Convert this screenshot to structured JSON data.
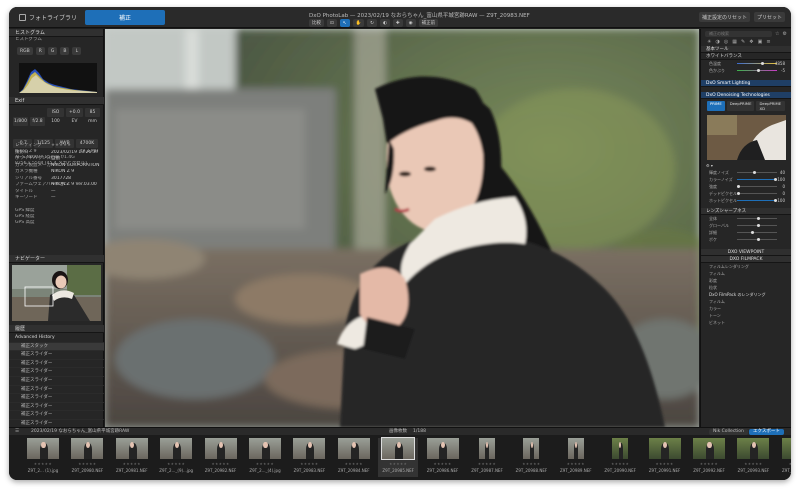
{
  "app": {
    "tab_library": "フォトライブラリ",
    "tab_edit": "補正",
    "window_title": "DxO PhotoLab — 2023/02/19 なおらちゃん_富山県平城宮跡RAW — Z9T_20983.NEF",
    "btn_compare": "比較",
    "btn_reset": "補正設定のリセット",
    "btn_preset": "プリセット",
    "btn_before": "補正前"
  },
  "left": {
    "histogram_header": "ヒストグラム",
    "histogram_label": "ヒストグラム",
    "exif_header": "Exif",
    "exif_row1": [
      "1/800",
      "f/2.8",
      "ISO 100",
      "+0.0 EV",
      "85 mm"
    ],
    "exif_row2": [
      "-0.7",
      "1/125",
      "AWB",
      "4700K"
    ],
    "camera": "Nikon Z 9",
    "camera_size": "49.1 MB",
    "lens": "AF-S NIKKOR 85mm f/1.4G",
    "dims": "8256 x 5504 (45.4 メガピクセル)",
    "meta_rows": [
      {
        "k": "レーティング",
        "v": "★★★★★"
      },
      {
        "k": "撮影日",
        "v": "2023/02/19 13:26:37"
      },
      {
        "k": "ホワイトバランス",
        "v": "自動"
      },
      {
        "k": "カメラ製造メーカー",
        "v": "NIKON CORPORATION"
      },
      {
        "k": "カメラ機種",
        "v": "NIKON Z 9"
      },
      {
        "k": "シリアル番号",
        "v": "3017728"
      },
      {
        "k": "ファームウェアバージョン",
        "v": "NIKON Z 9 Ver.03.00"
      },
      {
        "k": "タイトル",
        "v": "—"
      },
      {
        "k": "キーワード",
        "v": "—"
      }
    ],
    "gps_rows": [
      "GPS 緯度",
      "GPS 経度",
      "GPS 高度"
    ],
    "nav_header": "ナビゲーター",
    "history_header": "履歴",
    "history_group": "Advanced History",
    "history_items": [
      "補正スタック",
      "補正スライダー",
      "補正スライダー",
      "補正スライダー",
      "補正スライダー",
      "補正スライダー",
      "補正スライダー",
      "補正スライダー",
      "補正スライダー",
      "補正スライダー"
    ]
  },
  "right": {
    "search_placeholder": "補正の検索",
    "essential": "基本ツール",
    "wb": "ホワイトバランス",
    "wb_rows": [
      {
        "k": "色温度",
        "v": "4858"
      },
      {
        "k": "色かぶり",
        "v": "-5"
      }
    ],
    "smart": "DxO Smart Lighting",
    "deep": "DxO Denoising Technologies",
    "deep_mode1": "PRIME",
    "deep_mode2": "DeepPRIME",
    "deep_mode3": "DeepPRIME XD",
    "sliders": [
      {
        "k": "輝度ノイズ",
        "v": "40"
      },
      {
        "k": "カラーノイズ",
        "v": "100"
      },
      {
        "k": "強度",
        "v": "0"
      },
      {
        "k": "デッドピクセル",
        "v": "0"
      },
      {
        "k": "ホットピクセル",
        "v": "100"
      }
    ],
    "lens_header": "レンズシャープネス",
    "lens_rows": [
      "全体",
      "グローバル",
      "詳細",
      "ボケ"
    ],
    "viewpoint": "DXO VIEWPOINT",
    "filmpack": "DXO FILMPACK",
    "fp_rows": [
      "フィルムレンダリング",
      "フィルム",
      "彩度",
      "粒状"
    ],
    "fp_items": [
      "DxO FilmPack のレンダリング",
      "フィルム",
      "カラー",
      "トーン",
      "ビネット"
    ]
  },
  "filmbar": {
    "path": "2023/02/19 なおらちゃん_富山県平城宮跡RAW",
    "count_label": "画像枚数",
    "count": "1/188",
    "nik_btn": "Nik Collection",
    "export_btn": "エクスポート"
  },
  "thumbs": [
    "Z9T_2... (1).jpg",
    "Z9T_20980.NEF",
    "Z9T_20981.NEF",
    "Z9T_2..._(9)...jpg",
    "Z9T_20982.NEF",
    "Z9T_2..._(4).jpg",
    "Z9T_20983.NEF",
    "Z9T_20984.NEF",
    "Z9T_20985.NEF",
    "Z9T_20986.NEF",
    "Z9T_20987.NEF",
    "Z9T_20988.NEF",
    "Z9T_20989.NEF",
    "Z9T_20990.NEF",
    "Z9T_20991.NEF",
    "Z9T_20992.NEF",
    "Z9T_20993.NEF",
    "Z9T_20994.NEF"
  ],
  "colors": {
    "accent": "#1e6fb8",
    "panel": "#262626",
    "bg": "#1e1e1e"
  }
}
